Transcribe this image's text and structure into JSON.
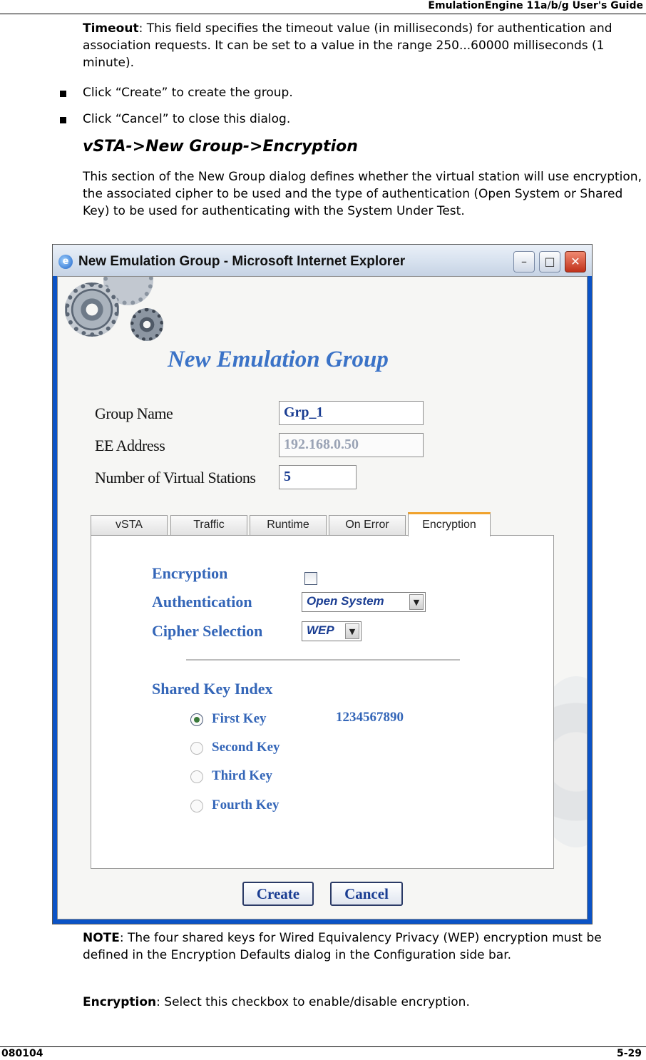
{
  "header": {
    "title": "EmulationEngine 11a/b/g User's Guide"
  },
  "intro": {
    "timeout_term": "Timeout",
    "timeout_text": ": This field specifies the timeout value (in milliseconds) for authentication and association requests. It can be set to a value in the range 250...60000 milliseconds (1 minute)."
  },
  "bullets": [
    "Click “Create” to create the group.",
    "Click “Cancel” to close this dialog."
  ],
  "section": {
    "title": "vSTA->New Group->Encryption",
    "body": "This section of the New Group dialog defines whether the virtual station will use encryption, the associated cipher to be used and the type of authentication (Open System or Shared Key) to be used for authenticating with the System Under Test."
  },
  "window": {
    "title": "New Emulation Group - Microsoft Internet Explorer",
    "app_title": "New Emulation Group",
    "form": {
      "group_name_label": "Group Name",
      "group_name_value": "Grp_1",
      "ee_address_label": "EE Address",
      "ee_address_value": "192.168.0.50",
      "num_stations_label": "Number of Virtual Stations",
      "num_stations_value": "5"
    },
    "tabs": [
      "vSTA",
      "Traffic",
      "Runtime",
      "On Error",
      "Encryption"
    ],
    "active_tab": "Encryption",
    "encryption": {
      "encryption_label": "Encryption",
      "encryption_checked": false,
      "authentication_label": "Authentication",
      "authentication_value": "Open System",
      "cipher_label": "Cipher Selection",
      "cipher_value": "WEP",
      "shared_key_label": "Shared Key Index",
      "keys": [
        "First Key",
        "Second Key",
        "Third Key",
        "Fourth Key"
      ],
      "selected_key": "First Key",
      "key_value": "1234567890"
    },
    "buttons": {
      "create": "Create",
      "cancel": "Cancel"
    }
  },
  "note": {
    "term": "NOTE",
    "text": ": The four shared keys for Wired Equivalency Privacy (WEP) encryption must be defined in the Encryption Defaults dialog in the Configuration side bar."
  },
  "encryption_desc": {
    "term": "Encryption",
    "text": ": Select this checkbox to enable/disable encryption."
  },
  "footer": {
    "left": "080104",
    "right": "5-29"
  },
  "colors": {
    "accent": "#3466b8",
    "tab_highlight": "#f0a22d"
  }
}
